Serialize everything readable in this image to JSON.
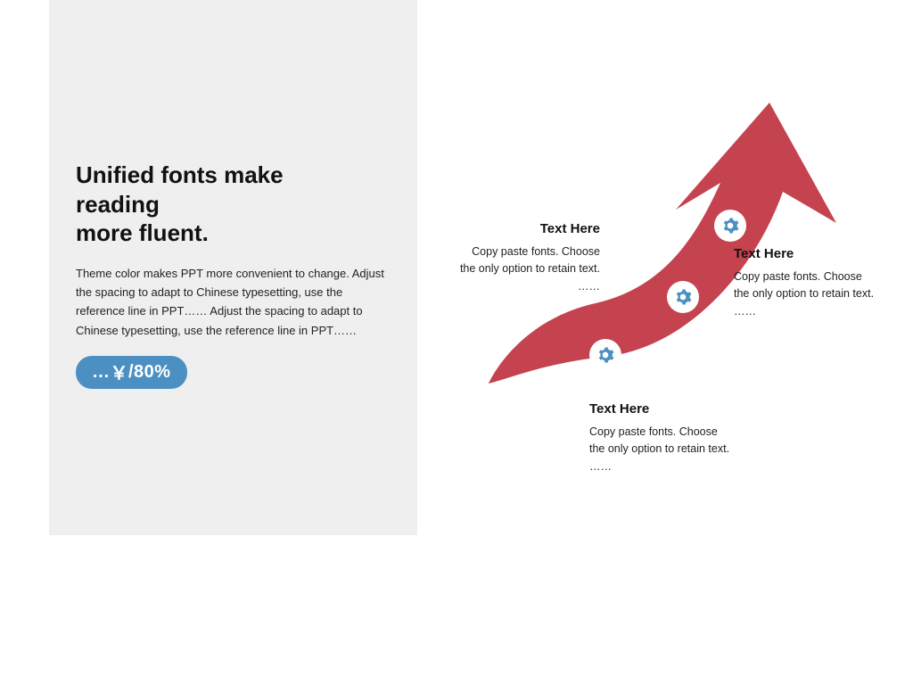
{
  "left": {
    "title_l1": "Unified fonts make",
    "title_l2": "reading",
    "title_l3": "more fluent.",
    "desc": "Theme color makes PPT more convenient to change. Adjust the spacing to adapt to Chinese typesetting, use the reference line in PPT…… Adjust the spacing to adapt to Chinese typesetting, use the reference line in PPT……",
    "badge_pre": "…",
    "badge_yen": "￥",
    "badge_post": "/80%"
  },
  "callouts": {
    "a": {
      "title": "Text Here",
      "body": "Copy paste fonts. Choose the only option to retain text.\n……"
    },
    "b": {
      "title": "Text Here",
      "body": "Copy paste fonts. Choose the only option to retain text.\n……"
    },
    "c": {
      "title": "Text Here",
      "body": "Copy paste fonts. Choose the only option to retain text.\n……"
    }
  },
  "colors": {
    "arrow": "#c4434f",
    "gear": "#4c90c3",
    "badge": "#4c90c3"
  }
}
